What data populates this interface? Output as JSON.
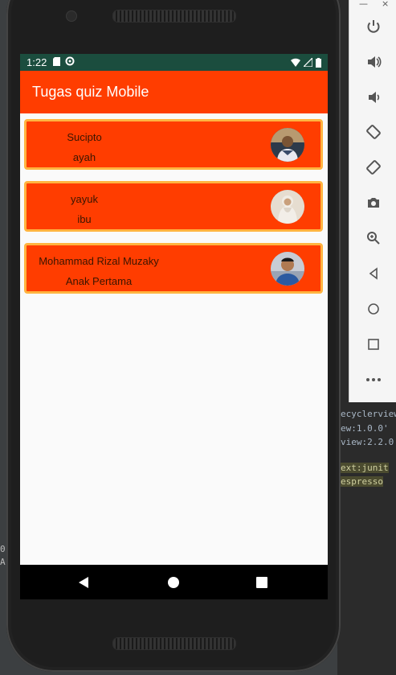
{
  "status_bar": {
    "time": "1:22"
  },
  "app_bar": {
    "title": "Tugas quiz Mobile"
  },
  "cards": [
    {
      "name": "Sucipto",
      "role": "ayah"
    },
    {
      "name": "yayuk",
      "role": "ibu"
    },
    {
      "name": "Mohammad Rizal Muzaky",
      "role": "Anak Pertama"
    }
  ],
  "ide": {
    "lines": [
      "ecyclerview",
      "ew:1.0.0'",
      "view:2.2.0",
      "ext:junit",
      "espresso"
    ],
    "left_chars": [
      "0",
      "A"
    ]
  },
  "toolbar": {
    "close": "×",
    "minimize": "—",
    "icons": [
      "power-icon",
      "volume-up-icon",
      "volume-down-icon",
      "rotate-left-icon",
      "rotate-right-icon",
      "camera-icon",
      "zoom-icon",
      "back-icon",
      "home-icon",
      "overview-icon",
      "more-icon"
    ]
  },
  "colors": {
    "primary": "#ff3d00",
    "status_bar": "#1b4d3e",
    "card_border": "#ffb440"
  }
}
